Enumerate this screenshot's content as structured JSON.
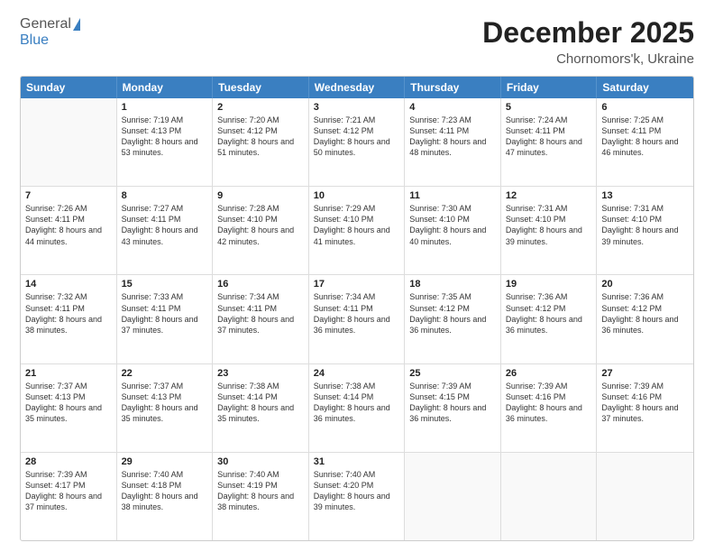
{
  "logo": {
    "general": "General",
    "blue": "Blue"
  },
  "header": {
    "month": "December 2025",
    "location": "Chornomors'k, Ukraine"
  },
  "days": [
    "Sunday",
    "Monday",
    "Tuesday",
    "Wednesday",
    "Thursday",
    "Friday",
    "Saturday"
  ],
  "weeks": [
    [
      {
        "day": "",
        "sunrise": "",
        "sunset": "",
        "daylight": ""
      },
      {
        "day": "1",
        "sunrise": "Sunrise: 7:19 AM",
        "sunset": "Sunset: 4:13 PM",
        "daylight": "Daylight: 8 hours and 53 minutes."
      },
      {
        "day": "2",
        "sunrise": "Sunrise: 7:20 AM",
        "sunset": "Sunset: 4:12 PM",
        "daylight": "Daylight: 8 hours and 51 minutes."
      },
      {
        "day": "3",
        "sunrise": "Sunrise: 7:21 AM",
        "sunset": "Sunset: 4:12 PM",
        "daylight": "Daylight: 8 hours and 50 minutes."
      },
      {
        "day": "4",
        "sunrise": "Sunrise: 7:23 AM",
        "sunset": "Sunset: 4:11 PM",
        "daylight": "Daylight: 8 hours and 48 minutes."
      },
      {
        "day": "5",
        "sunrise": "Sunrise: 7:24 AM",
        "sunset": "Sunset: 4:11 PM",
        "daylight": "Daylight: 8 hours and 47 minutes."
      },
      {
        "day": "6",
        "sunrise": "Sunrise: 7:25 AM",
        "sunset": "Sunset: 4:11 PM",
        "daylight": "Daylight: 8 hours and 46 minutes."
      }
    ],
    [
      {
        "day": "7",
        "sunrise": "Sunrise: 7:26 AM",
        "sunset": "Sunset: 4:11 PM",
        "daylight": "Daylight: 8 hours and 44 minutes."
      },
      {
        "day": "8",
        "sunrise": "Sunrise: 7:27 AM",
        "sunset": "Sunset: 4:11 PM",
        "daylight": "Daylight: 8 hours and 43 minutes."
      },
      {
        "day": "9",
        "sunrise": "Sunrise: 7:28 AM",
        "sunset": "Sunset: 4:10 PM",
        "daylight": "Daylight: 8 hours and 42 minutes."
      },
      {
        "day": "10",
        "sunrise": "Sunrise: 7:29 AM",
        "sunset": "Sunset: 4:10 PM",
        "daylight": "Daylight: 8 hours and 41 minutes."
      },
      {
        "day": "11",
        "sunrise": "Sunrise: 7:30 AM",
        "sunset": "Sunset: 4:10 PM",
        "daylight": "Daylight: 8 hours and 40 minutes."
      },
      {
        "day": "12",
        "sunrise": "Sunrise: 7:31 AM",
        "sunset": "Sunset: 4:10 PM",
        "daylight": "Daylight: 8 hours and 39 minutes."
      },
      {
        "day": "13",
        "sunrise": "Sunrise: 7:31 AM",
        "sunset": "Sunset: 4:10 PM",
        "daylight": "Daylight: 8 hours and 39 minutes."
      }
    ],
    [
      {
        "day": "14",
        "sunrise": "Sunrise: 7:32 AM",
        "sunset": "Sunset: 4:11 PM",
        "daylight": "Daylight: 8 hours and 38 minutes."
      },
      {
        "day": "15",
        "sunrise": "Sunrise: 7:33 AM",
        "sunset": "Sunset: 4:11 PM",
        "daylight": "Daylight: 8 hours and 37 minutes."
      },
      {
        "day": "16",
        "sunrise": "Sunrise: 7:34 AM",
        "sunset": "Sunset: 4:11 PM",
        "daylight": "Daylight: 8 hours and 37 minutes."
      },
      {
        "day": "17",
        "sunrise": "Sunrise: 7:34 AM",
        "sunset": "Sunset: 4:11 PM",
        "daylight": "Daylight: 8 hours and 36 minutes."
      },
      {
        "day": "18",
        "sunrise": "Sunrise: 7:35 AM",
        "sunset": "Sunset: 4:12 PM",
        "daylight": "Daylight: 8 hours and 36 minutes."
      },
      {
        "day": "19",
        "sunrise": "Sunrise: 7:36 AM",
        "sunset": "Sunset: 4:12 PM",
        "daylight": "Daylight: 8 hours and 36 minutes."
      },
      {
        "day": "20",
        "sunrise": "Sunrise: 7:36 AM",
        "sunset": "Sunset: 4:12 PM",
        "daylight": "Daylight: 8 hours and 36 minutes."
      }
    ],
    [
      {
        "day": "21",
        "sunrise": "Sunrise: 7:37 AM",
        "sunset": "Sunset: 4:13 PM",
        "daylight": "Daylight: 8 hours and 35 minutes."
      },
      {
        "day": "22",
        "sunrise": "Sunrise: 7:37 AM",
        "sunset": "Sunset: 4:13 PM",
        "daylight": "Daylight: 8 hours and 35 minutes."
      },
      {
        "day": "23",
        "sunrise": "Sunrise: 7:38 AM",
        "sunset": "Sunset: 4:14 PM",
        "daylight": "Daylight: 8 hours and 35 minutes."
      },
      {
        "day": "24",
        "sunrise": "Sunrise: 7:38 AM",
        "sunset": "Sunset: 4:14 PM",
        "daylight": "Daylight: 8 hours and 36 minutes."
      },
      {
        "day": "25",
        "sunrise": "Sunrise: 7:39 AM",
        "sunset": "Sunset: 4:15 PM",
        "daylight": "Daylight: 8 hours and 36 minutes."
      },
      {
        "day": "26",
        "sunrise": "Sunrise: 7:39 AM",
        "sunset": "Sunset: 4:16 PM",
        "daylight": "Daylight: 8 hours and 36 minutes."
      },
      {
        "day": "27",
        "sunrise": "Sunrise: 7:39 AM",
        "sunset": "Sunset: 4:16 PM",
        "daylight": "Daylight: 8 hours and 37 minutes."
      }
    ],
    [
      {
        "day": "28",
        "sunrise": "Sunrise: 7:39 AM",
        "sunset": "Sunset: 4:17 PM",
        "daylight": "Daylight: 8 hours and 37 minutes."
      },
      {
        "day": "29",
        "sunrise": "Sunrise: 7:40 AM",
        "sunset": "Sunset: 4:18 PM",
        "daylight": "Daylight: 8 hours and 38 minutes."
      },
      {
        "day": "30",
        "sunrise": "Sunrise: 7:40 AM",
        "sunset": "Sunset: 4:19 PM",
        "daylight": "Daylight: 8 hours and 38 minutes."
      },
      {
        "day": "31",
        "sunrise": "Sunrise: 7:40 AM",
        "sunset": "Sunset: 4:20 PM",
        "daylight": "Daylight: 8 hours and 39 minutes."
      },
      {
        "day": "",
        "sunrise": "",
        "sunset": "",
        "daylight": ""
      },
      {
        "day": "",
        "sunrise": "",
        "sunset": "",
        "daylight": ""
      },
      {
        "day": "",
        "sunrise": "",
        "sunset": "",
        "daylight": ""
      }
    ]
  ]
}
